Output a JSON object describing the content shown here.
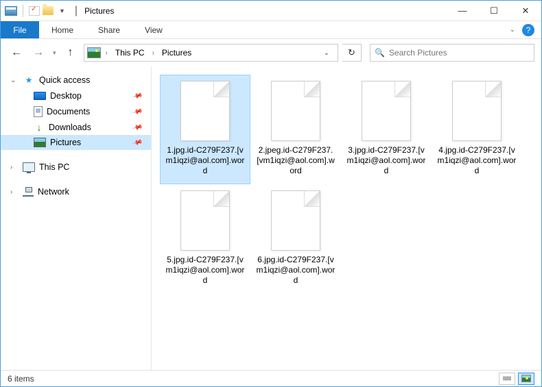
{
  "window": {
    "title": "Pictures"
  },
  "ribbon": {
    "file": "File",
    "tabs": [
      "Home",
      "Share",
      "View"
    ]
  },
  "breadcrumb": {
    "items": [
      "This PC",
      "Pictures"
    ]
  },
  "search": {
    "placeholder": "Search Pictures"
  },
  "sidebar": {
    "quick_access": {
      "label": "Quick access",
      "items": [
        {
          "label": "Desktop",
          "pinned": true
        },
        {
          "label": "Documents",
          "pinned": true
        },
        {
          "label": "Downloads",
          "pinned": true
        },
        {
          "label": "Pictures",
          "pinned": true,
          "selected": true
        }
      ]
    },
    "this_pc": {
      "label": "This PC"
    },
    "network": {
      "label": "Network"
    }
  },
  "files": [
    {
      "name": "1.jpg.id-C279F237.[vm1iqzi@aol.com].word",
      "selected": true
    },
    {
      "name": "2.jpeg.id-C279F237.[vm1iqzi@aol.com].word",
      "selected": false
    },
    {
      "name": "3.jpg.id-C279F237.[vm1iqzi@aol.com].word",
      "selected": false
    },
    {
      "name": "4.jpg.id-C279F237.[vm1iqzi@aol.com].word",
      "selected": false
    },
    {
      "name": "5.jpg.id-C279F237.[vm1iqzi@aol.com].word",
      "selected": false
    },
    {
      "name": "6.jpg.id-C279F237.[vm1iqzi@aol.com].word",
      "selected": false
    }
  ],
  "statusbar": {
    "item_count": "6 items"
  }
}
